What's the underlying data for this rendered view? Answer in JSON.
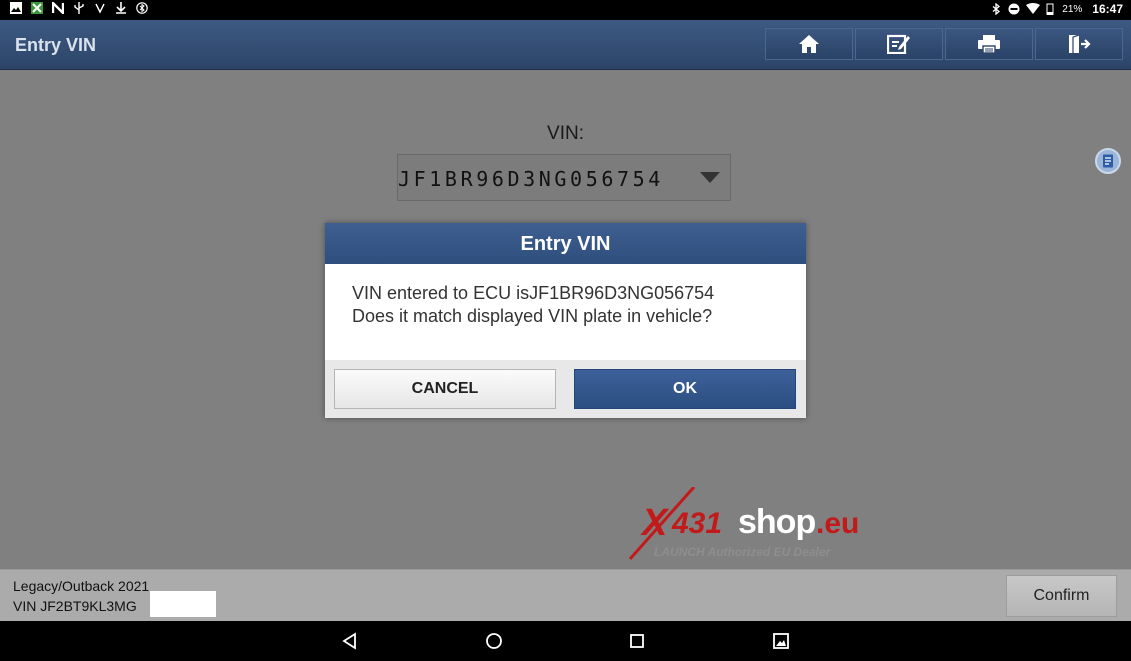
{
  "statusbar": {
    "battery": "21%",
    "time": "16:47"
  },
  "header": {
    "title": "Entry VIN",
    "toolbar": [
      "home-icon",
      "edit-icon",
      "print-icon",
      "exit-icon"
    ]
  },
  "main": {
    "vin_label": "VIN:",
    "vin_selected": "JF1BR96D3NG056754"
  },
  "dialog": {
    "title": "Entry VIN",
    "line1": "VIN entered to ECU isJF1BR96D3NG056754",
    "line2": "Does it match displayed VIN plate in vehicle?",
    "cancel_label": "CANCEL",
    "ok_label": "OK"
  },
  "watermark": {
    "x": "X",
    "num": "431",
    "shop": "shop",
    "tld": ".eu",
    "tagline": "LAUNCH Authorized EU Dealer"
  },
  "footer": {
    "model": "Legacy/Outback 2021",
    "vin": "VIN JF2BT9KL3MG",
    "confirm_label": "Confirm"
  },
  "colors": {
    "header": "#2f4a72",
    "dialog_header": "#345485",
    "ok_button": "#34578c",
    "content_bg": "#808080",
    "watermark_red": "#c21a1a"
  }
}
